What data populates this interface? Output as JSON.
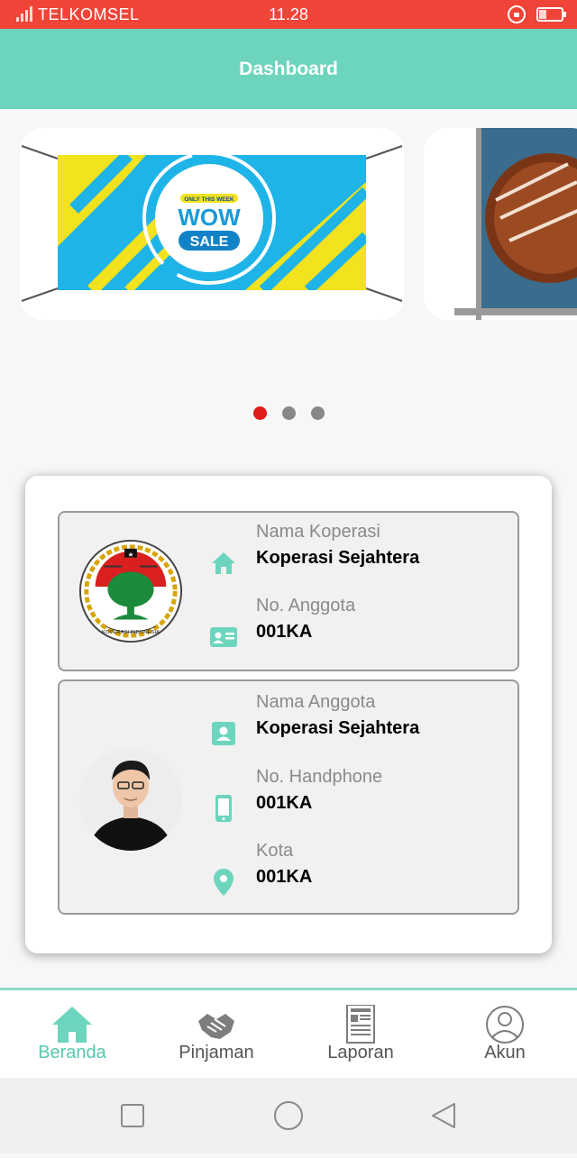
{
  "status_bar": {
    "carrier": "TELKOMSEL",
    "time": "11.28",
    "battery_level": 0.35
  },
  "header": {
    "title": "Dashboard"
  },
  "banner": {
    "slide1": {
      "tag": "ONLY THIS WEEK",
      "line1": "WOW",
      "line2": "SALE"
    },
    "page_count": 3,
    "active_page": 1,
    "colors": {
      "active_dot": "#e01b1b",
      "inactive_dot": "#888888"
    }
  },
  "cooperative": {
    "name_label": "Nama Koperasi",
    "name_value": "Koperasi Sejahtera",
    "member_no_label": "No. Anggota",
    "member_no_value": "001KA",
    "logo_text": "KOPERASI INDONESIA"
  },
  "member": {
    "name_label": "Nama Anggota",
    "name_value": "Koperasi Sejahtera",
    "phone_label": "No. Handphone",
    "phone_value": "001KA",
    "city_label": "Kota",
    "city_value": "001KA"
  },
  "bottom_nav": [
    {
      "label": "Beranda",
      "icon": "home-icon",
      "active": true
    },
    {
      "label": "Pinjaman",
      "icon": "handshake-icon",
      "active": false
    },
    {
      "label": "Laporan",
      "icon": "report-icon",
      "active": false
    },
    {
      "label": "Akun",
      "icon": "account-icon",
      "active": false
    }
  ],
  "colors": {
    "accent": "#6dd5be",
    "status_bar": "#f04438"
  }
}
